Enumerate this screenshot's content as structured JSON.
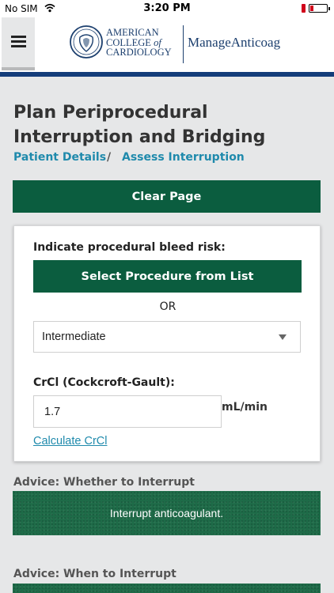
{
  "status_bar": {
    "carrier": "No SIM",
    "time": "3:20 PM",
    "battery_level": 0.2
  },
  "header": {
    "logo": {
      "line1": "AMERICAN",
      "line2a": "COLLEGE ",
      "line2b": "of",
      "line3": "CARDIOLOGY"
    },
    "product": "ManageAnticoag"
  },
  "page": {
    "title": "Plan Periprocedural Interruption and Bridging",
    "breadcrumb": [
      "Patient Details",
      "Assess Interruption"
    ],
    "breadcrumb_separator": "/",
    "clear_label": "Clear Page"
  },
  "form": {
    "bleed_risk_label": "Indicate procedural bleed risk:",
    "select_procedure_label": "Select Procedure from List",
    "or_text": "OR",
    "bleed_risk_value": "Intermediate",
    "crcl_label": "CrCl (Cockcroft-Gault):",
    "crcl_value": "1.7",
    "crcl_unit": "mL/min",
    "calculate_link": "Calculate CrCl"
  },
  "advice": [
    {
      "label": "Advice: Whether to Interrupt",
      "text": "Interrupt anticoagulant."
    },
    {
      "label": "Advice: When to Interrupt",
      "text": ""
    }
  ],
  "colors": {
    "primary_green": "#0b5d3f",
    "advice_green": "#1e6b48",
    "link": "#1f8aac",
    "navy": "#143d7a"
  },
  "icons": {
    "menu": "hamburger-icon",
    "wifi": "wifi-icon",
    "battery": "battery-icon",
    "caret": "caret-down-icon"
  }
}
